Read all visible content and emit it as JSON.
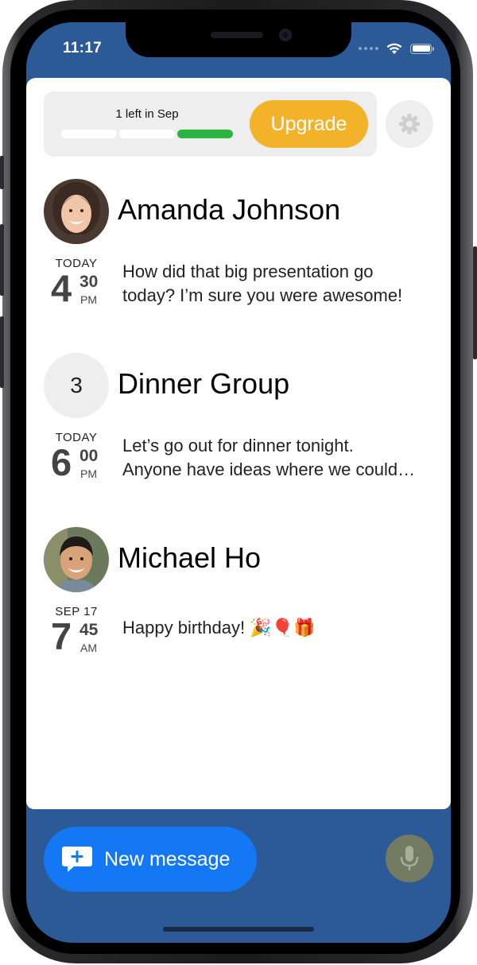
{
  "status_bar": {
    "time": "11:17"
  },
  "quota": {
    "label": "1 left in Sep",
    "segments_total": 3,
    "segments_used": 1,
    "used_color": "#2cb442",
    "upgrade_label": "Upgrade",
    "upgrade_color": "#f2b32a"
  },
  "settings": {
    "icon": "gear-icon"
  },
  "conversations": [
    {
      "name": "Amanda Johnson",
      "avatar": "photo",
      "day": "TODAY",
      "hour": "4",
      "minute": "30",
      "ampm": "PM",
      "preview_lines": [
        "How did that big presentation go",
        "today? I’m sure you were awesome!"
      ]
    },
    {
      "name": "Dinner Group",
      "avatar": "3",
      "day": "TODAY",
      "hour": "6",
      "minute": "00",
      "ampm": "PM",
      "preview_lines": [
        "Let’s go out for dinner tonight.",
        "Anyone have ideas where we could…"
      ]
    },
    {
      "name": "Michael Ho",
      "avatar": "photo",
      "day": "SEP 17",
      "hour": "7",
      "minute": "45",
      "ampm": "AM",
      "preview_lines": [
        "Happy birthday! 🎉🎈🎁"
      ]
    }
  ],
  "compose": {
    "label": "New message",
    "color": "#1478f5",
    "icon": "compose-plus-icon"
  },
  "mic": {
    "icon": "microphone-icon"
  },
  "colors": {
    "header_bg": "#2b5a97",
    "card_bg": "#ffffff"
  }
}
